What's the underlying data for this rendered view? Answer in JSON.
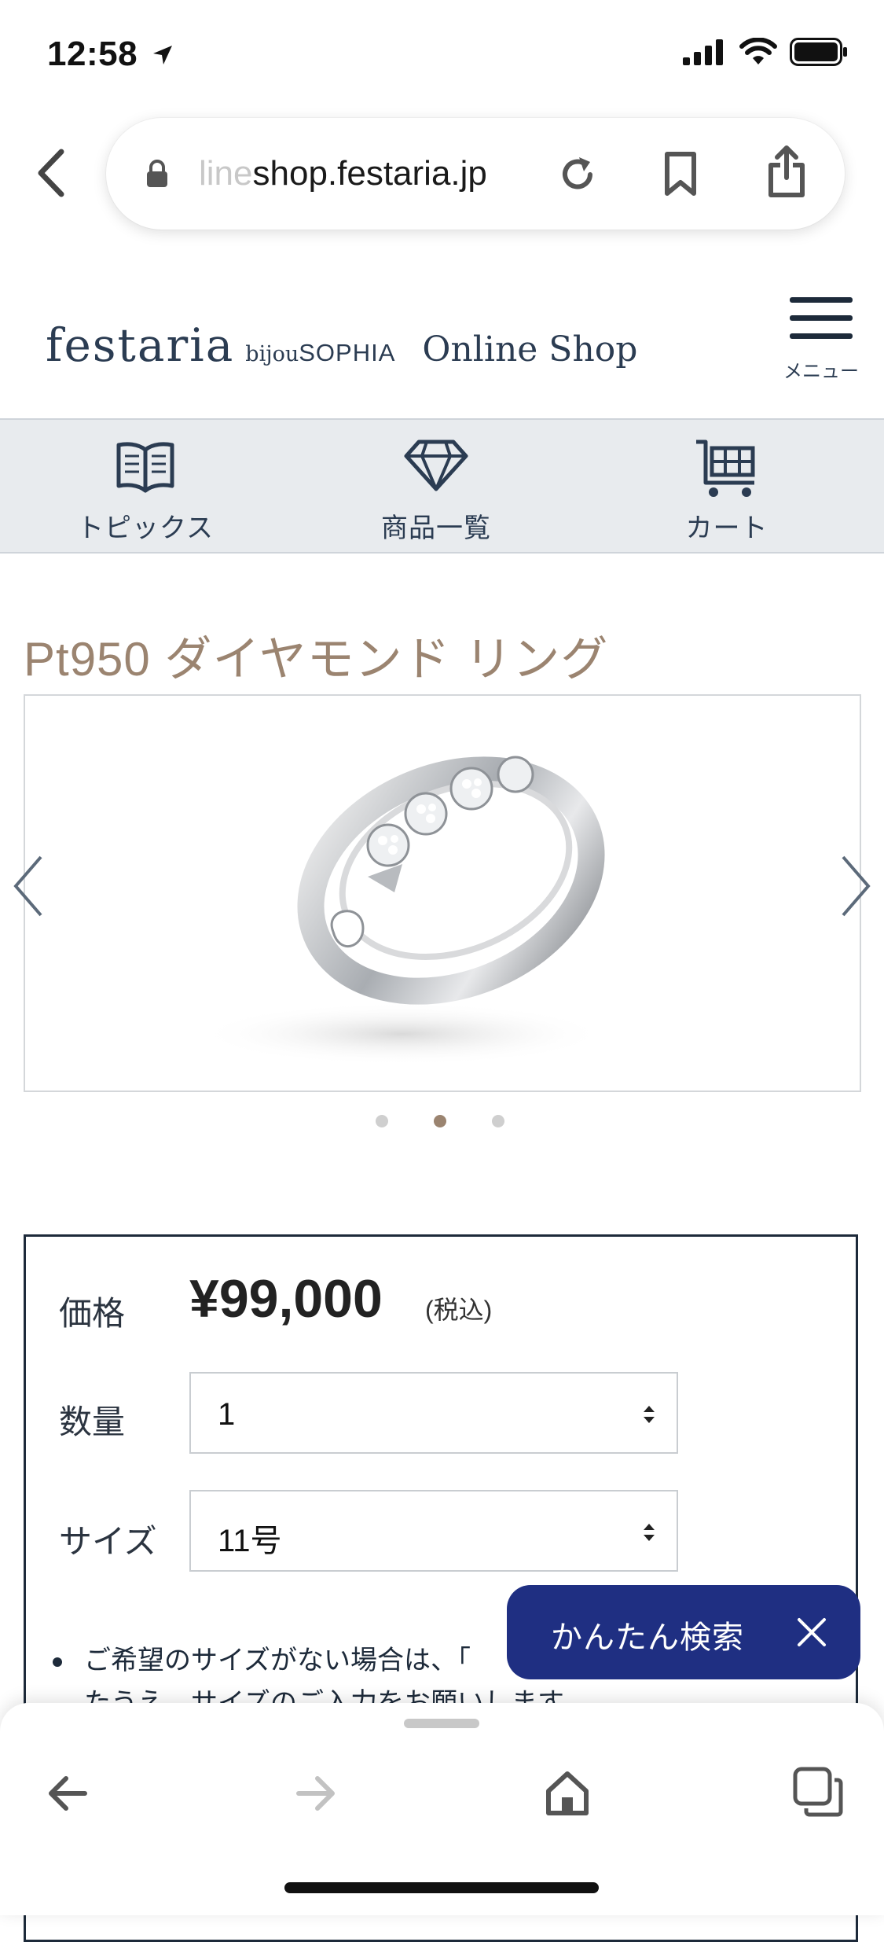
{
  "status_bar": {
    "time": "12:58"
  },
  "browser": {
    "url_faded": "line",
    "url_main": "shop.festaria.jp"
  },
  "header": {
    "logo_festaria": "festaria",
    "logo_bijou": "bijou",
    "logo_sophia": "SOPHIA",
    "logo_online_shop": "Online Shop",
    "menu_label": "メニュー"
  },
  "nav": [
    {
      "label": "トピックス",
      "icon": "book-icon"
    },
    {
      "label": "商品一覧",
      "icon": "diamond-icon"
    },
    {
      "label": "カート",
      "icon": "cart-icon"
    }
  ],
  "product": {
    "title": "Pt950 ダイヤモンド リング",
    "gallery": {
      "slide_count": 3,
      "active_slide": 2
    }
  },
  "purchase": {
    "price_label": "価格",
    "price": "¥99,000",
    "tax_note": "(税込)",
    "quantity_label": "数量",
    "quantity_value": "1",
    "size_label": "サイズ",
    "size_value": "11号",
    "note_line1": "ご希望のサイズがない場合は、「",
    "note_line2": "たうえ、サイズのご入力をお願いします。"
  },
  "quick_search": {
    "label": "かんたん検索"
  },
  "colors": {
    "title_brown": "#9b8470",
    "navy": "#1f2f82",
    "nav_bg": "#e8ebee",
    "logo": "#2b3c52"
  }
}
